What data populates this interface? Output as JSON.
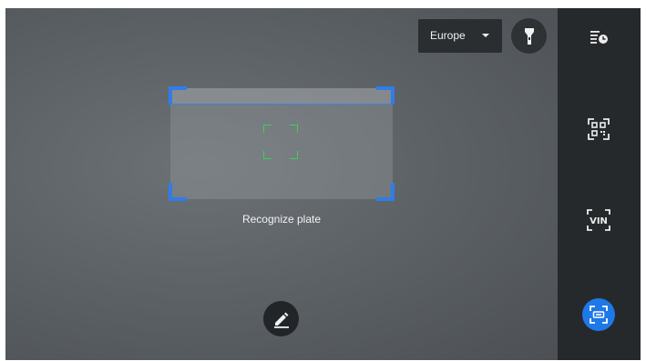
{
  "region_selector": {
    "value": "Europe",
    "icon": "dropdown-caret-icon"
  },
  "flashlight": {
    "icon": "flashlight-icon"
  },
  "scanner": {
    "label": "Recognize plate",
    "frame_color": "#2f7de8",
    "focus_color": "#35d25d"
  },
  "edit": {
    "icon": "edit-pencil-icon"
  },
  "sidebar": {
    "items": [
      {
        "name": "history",
        "icon": "history-list-clock-icon",
        "active": false
      },
      {
        "name": "qr-code",
        "icon": "qr-code-scan-icon",
        "active": false
      },
      {
        "name": "vin",
        "icon": "vin-scan-icon",
        "text": "VIN",
        "active": false
      },
      {
        "name": "plate",
        "icon": "plate-scan-icon",
        "active": true
      }
    ],
    "active_color": "#1e78e8"
  }
}
